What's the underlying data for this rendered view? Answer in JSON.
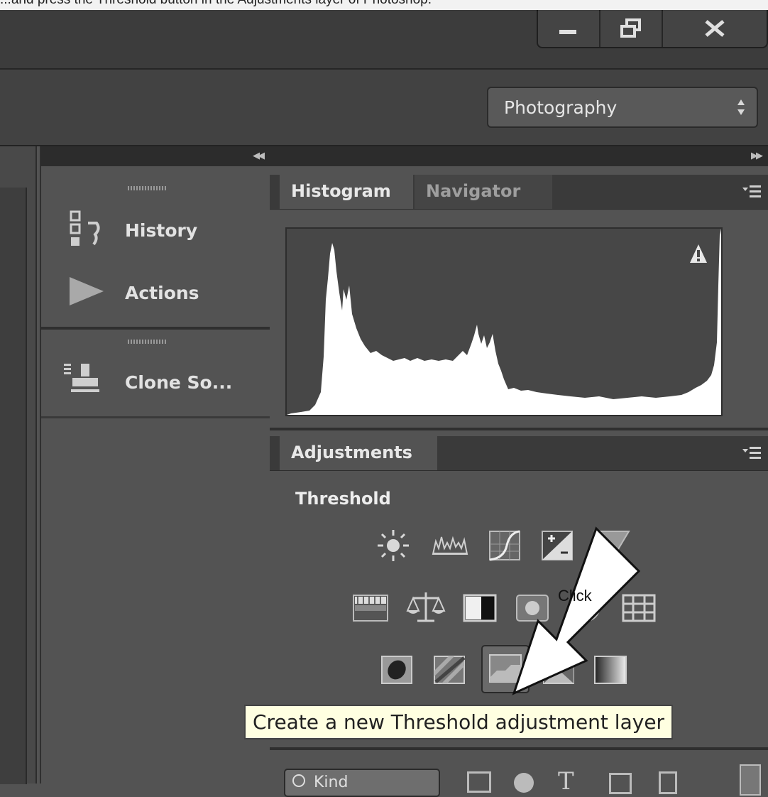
{
  "top_text": "...and press the Threshold button in the Adjustments layer of Photoshop.",
  "window_controls": {
    "minimize": "minimize",
    "restore": "restore",
    "close": "close"
  },
  "workspace": {
    "selected": "Photography"
  },
  "left_dock": {
    "items": [
      {
        "label": "History",
        "icon": "history-icon"
      },
      {
        "label": "Actions",
        "icon": "play-icon"
      },
      {
        "label": "Clone So...",
        "icon": "clone-stamp-icon"
      }
    ]
  },
  "histogram_panel": {
    "tabs": [
      "Histogram",
      "Navigator"
    ],
    "active_tab": "Histogram",
    "warning_icon": "warning-icon"
  },
  "adjustments_panel": {
    "tab": "Adjustments",
    "heading": "Threshold",
    "rows": [
      [
        "brightness-contrast",
        "levels",
        "curves",
        "exposure",
        "vibrance"
      ],
      [
        "hue-saturation",
        "color-balance",
        "black-white",
        "photo-filter",
        "channel-mixer",
        "color-lookup"
      ],
      [
        "invert",
        "posterize",
        "threshold",
        "selective-color",
        "gradient-map"
      ]
    ],
    "highlighted": "threshold"
  },
  "annotation": {
    "arrow_label": "Click"
  },
  "tooltip": {
    "text": "Create a new Threshold adjustment layer"
  },
  "layers_filter": {
    "kind_label": "Kind"
  },
  "colors": {
    "bg": "#535353",
    "panel_dark": "#3a3a3a",
    "tooltip_bg": "#ffffe1"
  }
}
